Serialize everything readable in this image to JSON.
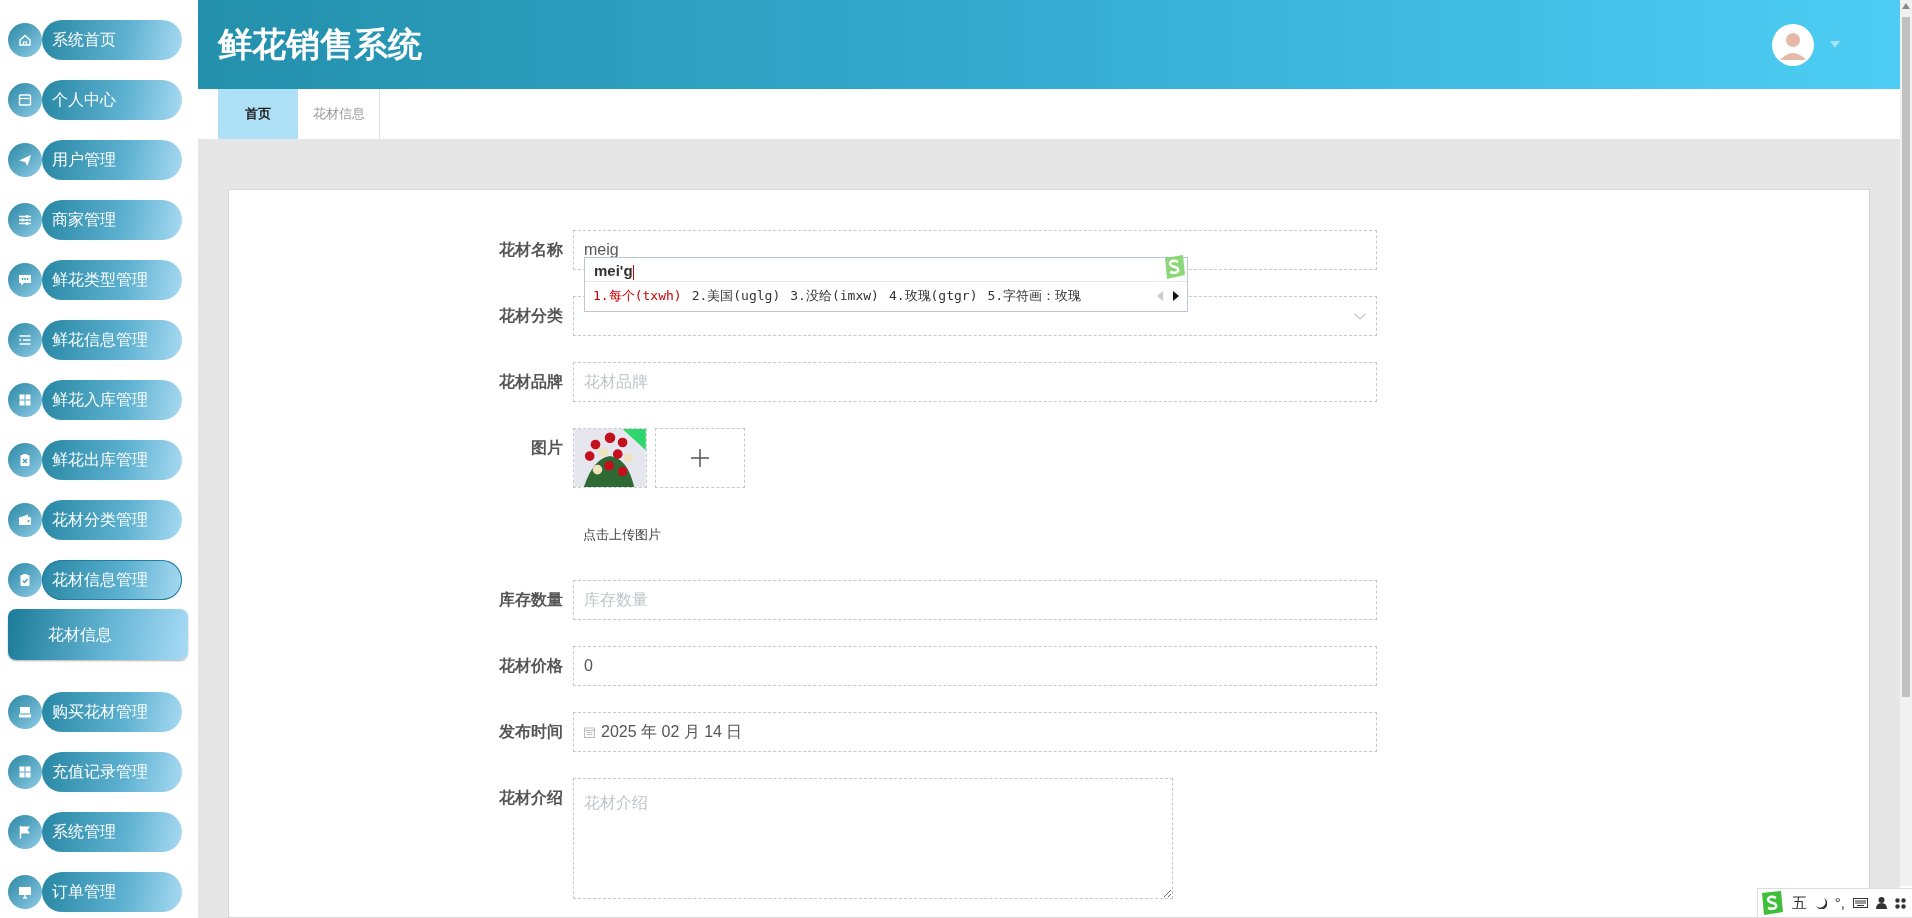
{
  "sidebar": {
    "items": [
      {
        "label": "系统首页",
        "expanded": false
      },
      {
        "label": "个人中心",
        "expanded": false
      },
      {
        "label": "用户管理",
        "expanded": false
      },
      {
        "label": "商家管理",
        "expanded": false
      },
      {
        "label": "鲜花类型管理",
        "expanded": false
      },
      {
        "label": "鲜花信息管理",
        "expanded": false
      },
      {
        "label": "鲜花入库管理",
        "expanded": false
      },
      {
        "label": "鲜花出库管理",
        "expanded": false
      },
      {
        "label": "花材分类管理",
        "expanded": false
      },
      {
        "label": "花材信息管理",
        "expanded": true,
        "children": [
          {
            "label": "花材信息",
            "selected": true
          }
        ]
      },
      {
        "label": "购买花材管理",
        "expanded": false
      },
      {
        "label": "充值记录管理",
        "expanded": false
      },
      {
        "label": "系统管理",
        "expanded": false
      },
      {
        "label": "订单管理",
        "expanded": false
      }
    ]
  },
  "header": {
    "title": "鲜花销售系统"
  },
  "tabs": [
    {
      "label": "首页",
      "selected": true
    },
    {
      "label": "花材信息",
      "selected": false
    }
  ],
  "form": {
    "fields": [
      {
        "kind": "text",
        "label": "花材名称",
        "value": "meig"
      },
      {
        "kind": "select",
        "label": "花材分类"
      },
      {
        "kind": "text",
        "label": "花材品牌",
        "placeholder": "花材品牌"
      },
      {
        "label": "图片",
        "hint": "点击上传图片"
      },
      {
        "kind": "text",
        "label": "库存数量",
        "placeholder": "库存数量"
      },
      {
        "kind": "text",
        "label": "花材价格",
        "value": "0"
      },
      {
        "kind": "date",
        "label": "发布时间",
        "value": "2025 年 02 月 14 日"
      },
      {
        "kind": "textarea",
        "label": "花材介绍",
        "placeholder": "花材介绍"
      }
    ]
  },
  "ime": {
    "composition": "mei'g",
    "candidates": [
      {
        "text": "1.每个(txwh)",
        "selected": true
      },
      {
        "text": "2.美国(uglg)",
        "selected": false
      },
      {
        "text": "3.没给(imxw)",
        "selected": false
      },
      {
        "text": "4.玫瑰(gtgr)",
        "selected": false
      },
      {
        "text": "5.字符画：玫瑰",
        "selected": false
      }
    ]
  },
  "ime_toolbar": {
    "mode": "五",
    "punctuation": "°,"
  }
}
